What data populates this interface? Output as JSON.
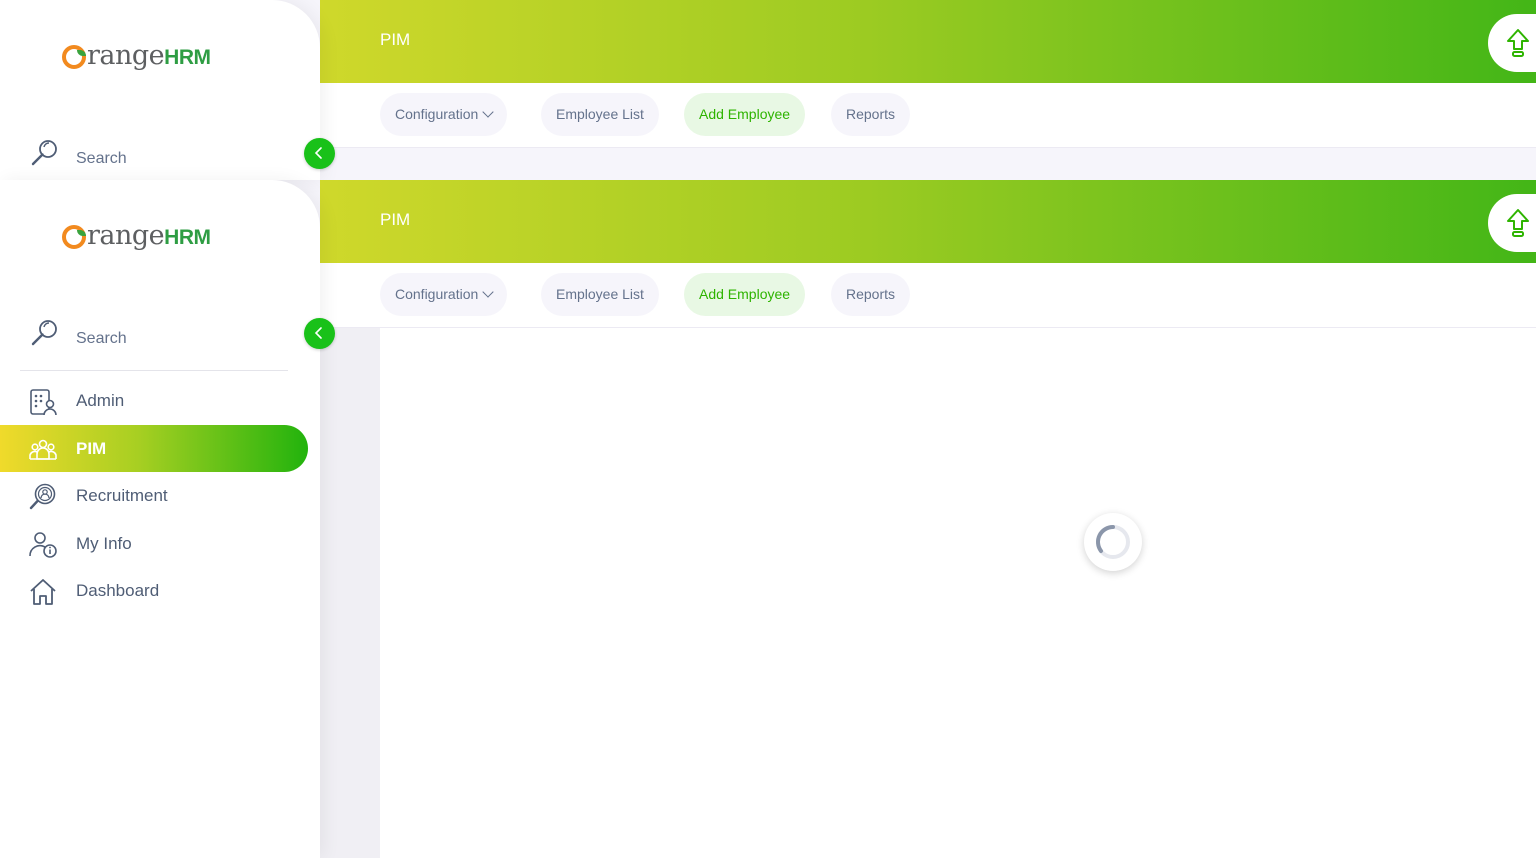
{
  "brand": {
    "logo_word": "range",
    "logo_suffix": "HRM",
    "primary_color": "#2eb400",
    "accent_orange": "#f28a1f"
  },
  "header": {
    "title": "PIM"
  },
  "top_nav": {
    "tabs": [
      {
        "label": "Configuration",
        "has_dropdown": true,
        "active": false
      },
      {
        "label": "Employee List",
        "active": false
      },
      {
        "label": "Add Employee",
        "active": true
      },
      {
        "label": "Reports",
        "active": false
      }
    ]
  },
  "sidebar": {
    "search_label": "Search",
    "items": [
      {
        "label": "Admin",
        "icon": "admin-icon",
        "active": false
      },
      {
        "label": "PIM",
        "icon": "pim-icon",
        "active": true
      },
      {
        "label": "Recruitment",
        "icon": "recruitment-icon",
        "active": false
      },
      {
        "label": "My Info",
        "icon": "my-info-icon",
        "active": false
      },
      {
        "label": "Dashboard",
        "icon": "dashboard-icon",
        "active": false
      }
    ]
  },
  "content": {
    "state": "loading"
  }
}
